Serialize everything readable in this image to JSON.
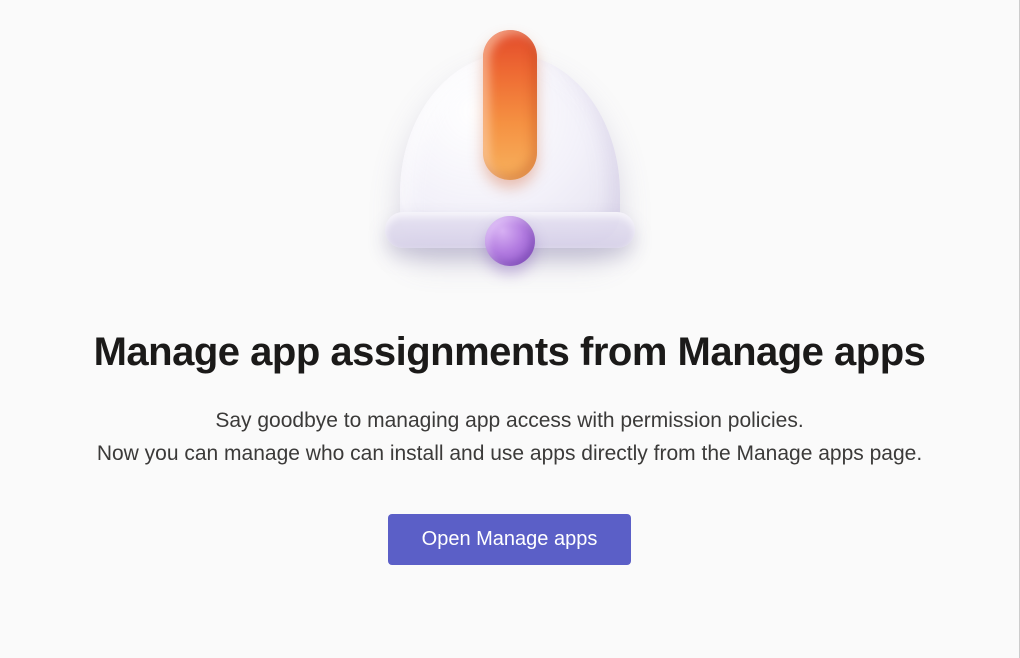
{
  "illustration": {
    "icon_name": "bell-exclamation-icon"
  },
  "heading": "Manage app assignments from Manage apps",
  "description": "Say goodbye to managing app access with permission policies.\nNow you can manage who can install and use apps directly from the Manage apps page.",
  "cta_label": "Open Manage apps",
  "colors": {
    "primary_button": "#5b5fc7",
    "accent_orange_top": "#e24a2b",
    "accent_orange_bottom": "#f7b25e",
    "accent_purple": "#8d54c8"
  }
}
